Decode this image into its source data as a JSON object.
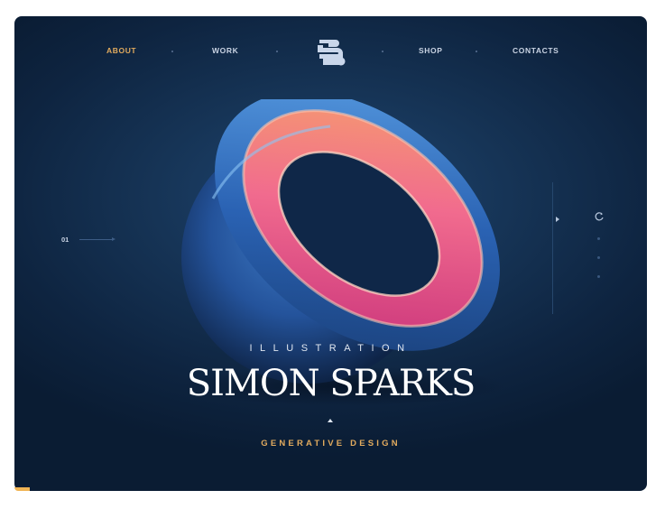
{
  "nav": {
    "left": [
      {
        "label": "ABOUT",
        "active": true
      },
      {
        "label": "WORK",
        "active": false
      }
    ],
    "right": [
      {
        "label": "SHOP",
        "active": false
      },
      {
        "label": "CONTACTS",
        "active": false
      }
    ],
    "logo_icon": "ss-monogram-logo"
  },
  "slider": {
    "index": "01"
  },
  "hero": {
    "eyebrow": "ILLUSTRATION",
    "title": "SIMON SPARKS",
    "subtitle": "GENERATIVE DESIGN"
  },
  "icons": {
    "play": "play-icon",
    "refresh": "refresh-icon",
    "scroll_up": "caret-up-icon"
  },
  "colors": {
    "accent": "#e2ab5e",
    "background": "#102a48",
    "text": "#ffffff"
  }
}
